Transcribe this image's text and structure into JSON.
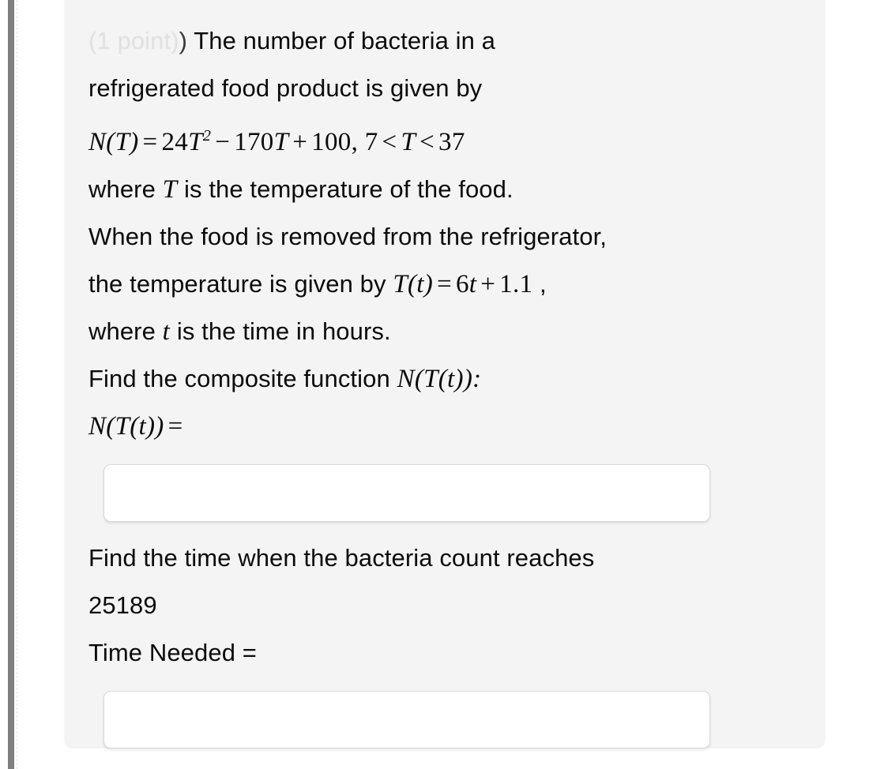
{
  "page": {
    "background": "#ffffff",
    "card_background": "#f4f4f4"
  },
  "problem": {
    "points_label": "(1 point)",
    "points_closing_paren": ")",
    "intro_line_1": "The number of bacteria in a",
    "intro_line_2": "refrigerated food product is given by",
    "equation_N": {
      "lhs": "N(T)",
      "eq": "=",
      "term_1_coef": "24",
      "term_1_var": "T",
      "term_1_exp": "2",
      "minus": "−",
      "term_2": "170",
      "term_2_var": "T",
      "plus": "+",
      "term_3": "100",
      "comma": ",",
      "domain_low": "7",
      "lt_1": "<",
      "domain_var": "T",
      "lt_2": "<",
      "domain_high": "37"
    },
    "where_T_pre": "where ",
    "where_T_var": "T",
    "where_T_post": " is the temperature of the food.",
    "removed_line": "When the food is removed from the refrigerator,",
    "temp_pre": "the temperature is given by ",
    "equation_T": {
      "lhs": "T(t)",
      "eq": "=",
      "coef": "6",
      "var": "t",
      "plus": "+",
      "constant": "1.1"
    },
    "temp_post": ",",
    "where_t_pre": "where ",
    "where_t_var": "t",
    "where_t_post": " is the time in hours.",
    "find_composite_pre": "Find the composite function ",
    "find_composite_expr": "N(T(t))",
    "find_composite_colon": ":",
    "composite_prompt_expr": "N(T(t))",
    "composite_prompt_eq": "=",
    "answer_1": {
      "value": "",
      "placeholder": ""
    },
    "find_time_line_1": "Find the time when the bacteria count reaches",
    "find_time_line_2": "25189",
    "time_needed_label": "Time Needed =",
    "answer_2": {
      "value": "",
      "placeholder": ""
    }
  }
}
